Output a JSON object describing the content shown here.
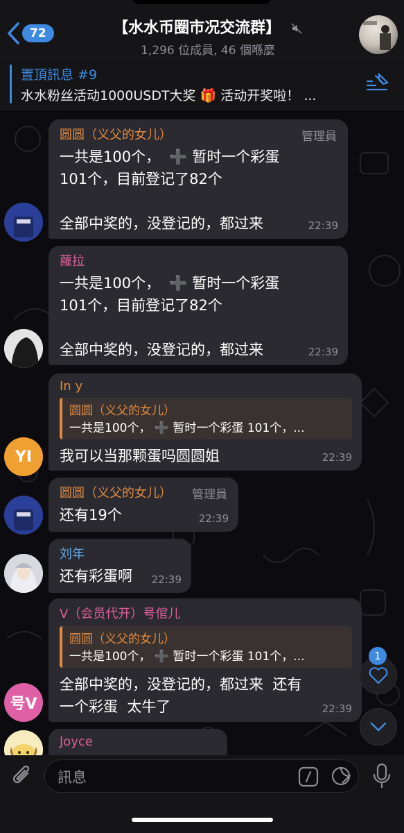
{
  "header": {
    "back_count": "72",
    "title": "【水水币圈市况交流群】",
    "subtitle": "1,296 位成員, 46 個喺麼"
  },
  "pinned": {
    "label": "置頂訊息 #9",
    "text": "水水粉丝活动1000USDT大奖 🎁 活动开奖啦！ ..."
  },
  "messages": [
    {
      "sender": "圆圆（义父的女儿）",
      "sender_color": "#e08a3e",
      "role": "管理員",
      "text": "一共是100个，  ➕ 暂时一个彩蛋\n101个，目前登记了82个\n\n全部中奖的，没登记的，都过来",
      "time": "22:39"
    },
    {
      "sender": "蘿拉",
      "sender_color": "#e0609a",
      "text": "一共是100个，  ➕ 暂时一个彩蛋\n101个，目前登记了82个\n\n全部中奖的，没登记的，都过来",
      "time": "22:39"
    },
    {
      "sender": "In y",
      "sender_color": "#e08a3e",
      "reply_name": "圆圆（义父的女儿）",
      "reply_text": "一共是100个，  ➕ 暂时一个彩蛋 101个，...",
      "text": "我可以当那颗蛋吗圆圆姐",
      "time": "22:39",
      "avatar_initials": "YI"
    },
    {
      "sender": "圆圆（义父的女儿）",
      "sender_color": "#e08a3e",
      "role": "管理員",
      "text": "还有19个",
      "time": "22:39"
    },
    {
      "sender": "刘年",
      "sender_color": "#5fa8e8",
      "text": "还有彩蛋啊",
      "time": "22:39"
    },
    {
      "sender": "V（会员代开）号倌儿",
      "sender_color": "#e0609a",
      "reply_name": "圆圆（义父的女儿）",
      "reply_text": "一共是100个，  ➕ 暂时一个彩蛋 101个，...",
      "text": "全部中奖的，没登记的，都过来  还有\n一个彩蛋  太牛了",
      "time": "22:39",
      "avatar_initials": "号V"
    },
    {
      "sender": "Joyce",
      "sender_color": "#e0609a"
    }
  ],
  "reaction_badge": "1",
  "input": {
    "placeholder": "訊息"
  },
  "colors": {
    "accent": "#3e8ae0",
    "bubble": "#2a2a30",
    "admin_orange": "#e08a3e",
    "pink": "#e0609a"
  }
}
